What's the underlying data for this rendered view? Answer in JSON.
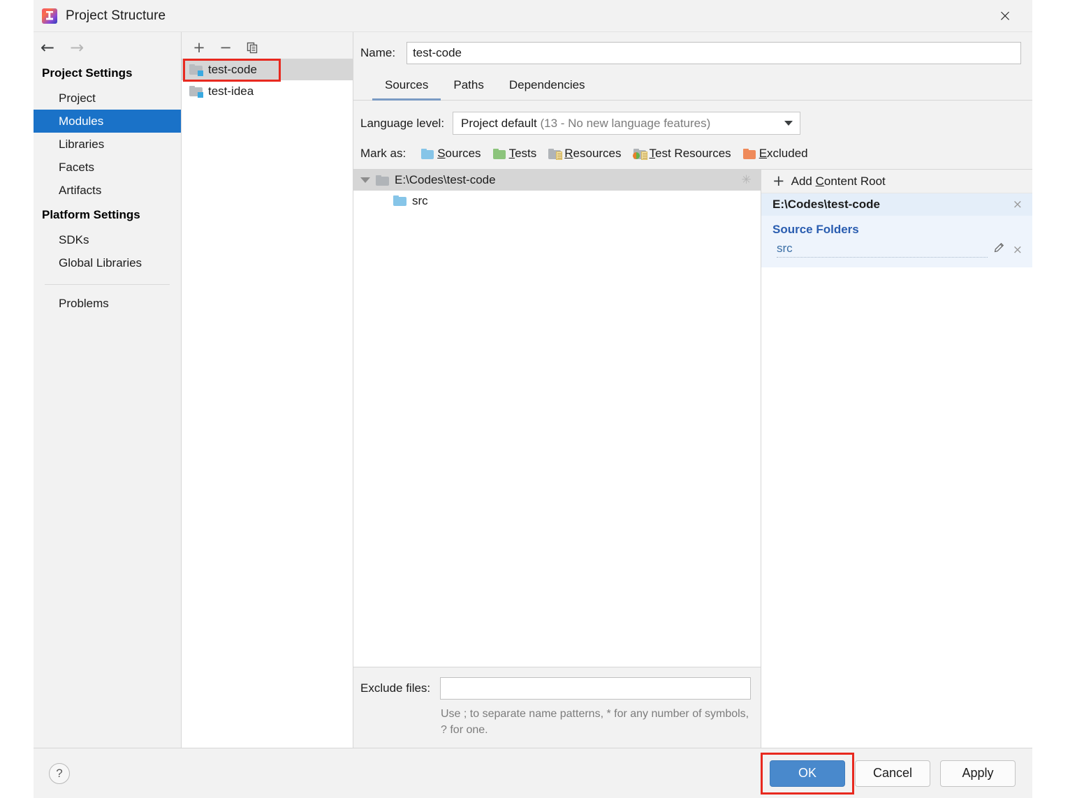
{
  "window": {
    "title": "Project Structure",
    "app_icon": "intellij-idea-icon",
    "close_icon": "×"
  },
  "navigation": {
    "back_icon": "←",
    "forward_icon": "→"
  },
  "sidebar": {
    "groups": [
      {
        "title": "Project Settings",
        "items": [
          {
            "label": "Project",
            "selected": false
          },
          {
            "label": "Modules",
            "selected": true
          },
          {
            "label": "Libraries",
            "selected": false
          },
          {
            "label": "Facets",
            "selected": false
          },
          {
            "label": "Artifacts",
            "selected": false
          }
        ]
      },
      {
        "title": "Platform Settings",
        "items": [
          {
            "label": "SDKs",
            "selected": false
          },
          {
            "label": "Global Libraries",
            "selected": false
          }
        ]
      }
    ],
    "problems_label": "Problems"
  },
  "modules_panel": {
    "toolbar": {
      "add_icon": "+",
      "remove_icon": "−",
      "copy_icon": "copy-icon"
    },
    "items": [
      {
        "label": "test-code",
        "selected": true,
        "highlighted": true
      },
      {
        "label": "test-idea",
        "selected": false,
        "highlighted": false
      }
    ]
  },
  "module_detail": {
    "name_label": "Name:",
    "name_value": "test-code",
    "tabs": [
      {
        "label": "Sources",
        "active": true
      },
      {
        "label": "Paths",
        "active": false
      },
      {
        "label": "Dependencies",
        "active": false
      }
    ],
    "language_level": {
      "label": "Language level:",
      "value_main": "Project default",
      "value_detail": "(13 - No new language features)"
    },
    "mark_as": {
      "label": "Mark as:",
      "options": [
        {
          "label": "Sources",
          "mnemonic": "S",
          "rest": "ources",
          "color": "#86c5e8",
          "kind": "plain"
        },
        {
          "label": "Tests",
          "mnemonic": "T",
          "rest": "ests",
          "color": "#8cc47c",
          "kind": "plain"
        },
        {
          "label": "Resources",
          "mnemonic": "R",
          "rest": "esources",
          "color": "#b0b4b8",
          "kind": "lines"
        },
        {
          "label": "Test Resources",
          "mnemonic": "T",
          "rest": "est Resources",
          "color": "#b0b4b8",
          "kind": "testres"
        },
        {
          "label": "Excluded",
          "mnemonic": "E",
          "rest": "xcluded",
          "color": "#ef8a5a",
          "kind": "plain"
        }
      ]
    },
    "tree": {
      "root_label": "E:\\Codes\\test-code",
      "root_expanded": true,
      "spinner_icon": "loading-spinner",
      "children": [
        {
          "label": "src",
          "type": "source-folder"
        }
      ]
    },
    "exclude": {
      "label": "Exclude files:",
      "value": "",
      "hint_line1": "Use ; to separate name patterns, * for any number of",
      "hint_line2": "symbols, ? for one."
    }
  },
  "content_roots": {
    "add_label_prefix": "Add ",
    "add_label_mnemonic": "C",
    "add_label_rest": "ontent Root",
    "add_icon": "+",
    "root_path": "E:\\Codes\\test-code",
    "remove_icon": "×",
    "source_folders_title": "Source Folders",
    "folders": [
      {
        "name": "src",
        "edit_icon": "pencil-icon",
        "remove_icon": "×"
      }
    ]
  },
  "footer": {
    "help_icon": "?",
    "ok_label": "OK",
    "cancel_label": "Cancel",
    "apply_label": "Apply"
  },
  "colors": {
    "accent_blue": "#1a72c8",
    "primary_button": "#4989cc",
    "highlight_red": "#e8291f",
    "link_blue": "#3a6ea5",
    "section_blue": "#2a5db0"
  }
}
